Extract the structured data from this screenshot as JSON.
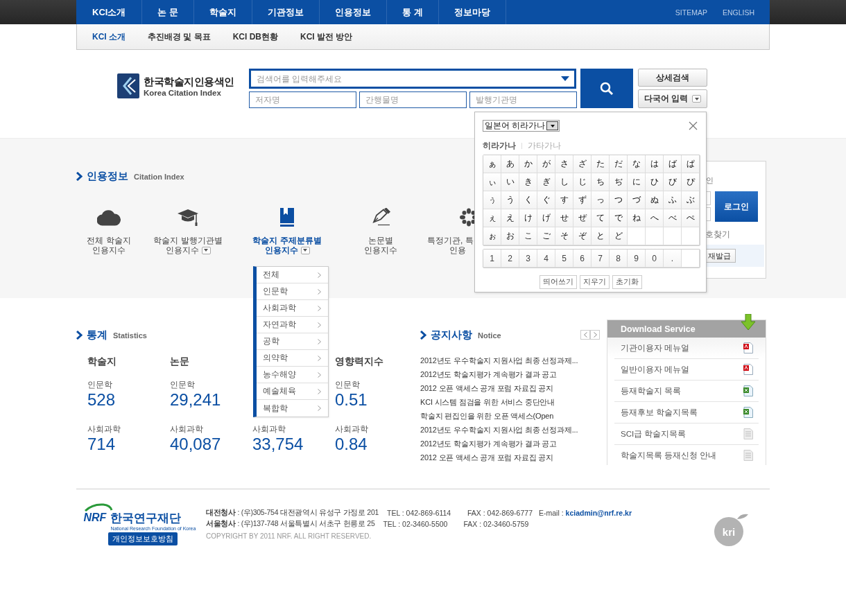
{
  "top_nav": {
    "items": [
      "KCI소개",
      "논 문",
      "학술지",
      "기관정보",
      "인용정보",
      "통 계",
      "정보마당"
    ],
    "links": [
      "SITEMAP",
      "ENGLISH"
    ]
  },
  "sub_nav": [
    {
      "label": "KCI 소개",
      "selected": true
    },
    {
      "label": "추진배경 및 목표",
      "selected": false
    },
    {
      "label": "KCI DB현황",
      "selected": false
    },
    {
      "label": "KCI 발전 방안",
      "selected": false
    }
  ],
  "logo": {
    "title": "한국학술지인용색인",
    "subtitle": "Korea Citation Index"
  },
  "search": {
    "placeholder": "검색어를 입력해주세요",
    "fields": [
      {
        "placeholder": "저자명"
      },
      {
        "placeholder": "간행물명"
      },
      {
        "placeholder": "발행기관명"
      }
    ],
    "buttons": [
      "상세검색",
      "다국어 입력"
    ]
  },
  "citation": {
    "title": "인용정보",
    "subtitle": "Citation Index",
    "items": [
      {
        "kind": "cloud",
        "lines": [
          "전체 학술지",
          "인용지수"
        ],
        "dropdown": false,
        "selected": false
      },
      {
        "kind": "cap",
        "lines": [
          "학술지 발행기관별",
          "인용지수"
        ],
        "dropdown": true,
        "selected": false
      },
      {
        "kind": "book",
        "lines": [
          "학술지 주제분류별",
          "인용지수"
        ],
        "dropdown": true,
        "selected": true
      },
      {
        "kind": "pen",
        "lines": [
          "논문별",
          "인용지수"
        ],
        "dropdown": false,
        "selected": false
      },
      {
        "kind": "flower",
        "lines": [
          "특정기관, 특",
          "인용"
        ],
        "dropdown": false,
        "selected": false
      }
    ]
  },
  "subject_menu": [
    "전체",
    "인문학",
    "사회과학",
    "자연과학",
    "공학",
    "의약학",
    "농수해양",
    "예술체육",
    "복합학"
  ],
  "login": {
    "title": "인",
    "button": "로그인",
    "find": "호찾기",
    "reissue": "재발급"
  },
  "keyboard": {
    "language": "일본어 히라가나",
    "tabs": [
      {
        "label": "히라가나",
        "selected": true
      },
      {
        "label": "가타가나",
        "selected": false
      }
    ],
    "rows": [
      [
        "ぁ",
        "あ",
        "か",
        "が",
        "さ",
        "ざ",
        "た",
        "だ",
        "な",
        "は",
        "ば",
        "ぱ"
      ],
      [
        "ぃ",
        "い",
        "き",
        "ぎ",
        "し",
        "じ",
        "ち",
        "ぢ",
        "に",
        "ひ",
        "び",
        "ぴ"
      ],
      [
        "ぅ",
        "う",
        "く",
        "ぐ",
        "す",
        "ず",
        "っ",
        "つ",
        "づ",
        "ぬ",
        "ふ",
        "ぶ"
      ],
      [
        "ぇ",
        "え",
        "け",
        "げ",
        "せ",
        "ぜ",
        "て",
        "で",
        "ね",
        "へ",
        "べ",
        "ぺ"
      ],
      [
        "ぉ",
        "お",
        "こ",
        "ご",
        "そ",
        "ぞ",
        "と",
        "ど"
      ]
    ],
    "digits": [
      "1",
      "2",
      "3",
      "4",
      "5",
      "6",
      "7",
      "8",
      "9",
      "0",
      "."
    ],
    "buttons": [
      "띄어쓰기",
      "지우기",
      "초기화"
    ]
  },
  "statistics": {
    "title": "통계",
    "subtitle": "Statistics",
    "columns": [
      {
        "heading": "학술지",
        "entries": [
          {
            "label": "인문학",
            "value": "528"
          },
          {
            "label": "사회과학",
            "value": "714"
          }
        ]
      },
      {
        "heading": "논문",
        "entries": [
          {
            "label": "인문학",
            "value": "29,241"
          },
          {
            "label": "사회과학",
            "value": "40,087"
          }
        ]
      },
      {
        "entries": [
          {
            "label": "사회과학",
            "value": "33,754"
          }
        ]
      },
      {
        "heading": "영향력지수",
        "entries": [
          {
            "label": "인문학",
            "value": "0.51"
          },
          {
            "label": "사회과학",
            "value": "0.84"
          }
        ]
      }
    ]
  },
  "notice": {
    "title": "공지사항",
    "subtitle": "Notice",
    "items": [
      "2012년도 우수학술지 지원사업 최종 선정과제...",
      "2012년도 학술지평가 계속평가 결과 공고",
      "2012 오픈 액세스 공개 포럼 자료집 공지",
      "KCI 시스템 점검을 위한 서비스 중단안내",
      "학술지 편집인을 위한 오픈 액세스(Open",
      "2012년도 우수학술지 지원사업 최종 선정과제...",
      "2012년도 학술지평가 계속평가 결과 공고",
      "2012 오픈 액세스 공개 포럼 자료집 공지"
    ]
  },
  "downloads": {
    "title": "Download Service",
    "items": [
      {
        "label": "기관이용자 메뉴얼",
        "kind": "pdf"
      },
      {
        "label": "일반이용자 메뉴얼",
        "kind": "pdf"
      },
      {
        "label": "등재학술지 목록",
        "kind": "xls"
      },
      {
        "label": "등재후보 학술지목록",
        "kind": "xls"
      },
      {
        "label": "SCI급 학술지목록",
        "kind": "doc"
      },
      {
        "label": "학술지목록 등재신청 안내",
        "kind": "doc"
      }
    ]
  },
  "footer": {
    "logo_mark": "NRF",
    "org": "한국연구재단",
    "org_en": "National Research Foundation of Korea",
    "privacy": "개인정보보호방침",
    "addresses": [
      {
        "office": "대전청사",
        "address": ": (우)305-754 대전광역시 유성구 가정로 201",
        "tel": "TEL : 042-869-6114",
        "fax": "FAX : 042-869-6777",
        "email_label": "E-mail :",
        "email": "kciadmin@nrf.re.kr"
      },
      {
        "office": "서울청사",
        "address": ": (우)137-748 서울특별시 서초구 헌릉로 25",
        "tel": "TEL : 02-3460-5500",
        "fax": "FAX : 02-3460-5759"
      }
    ],
    "copyright": "COPYRIGHT BY 2011 NRF. ALL RIGHT RESERVED.",
    "badge": "kri"
  }
}
